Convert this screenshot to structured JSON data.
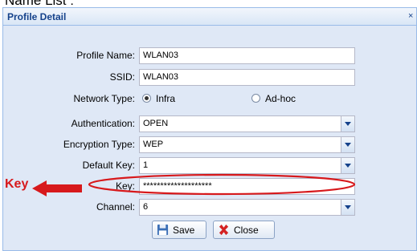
{
  "caption": "Name List :",
  "dialog": {
    "title": "Profile Detail",
    "close_glyph": "×"
  },
  "form": {
    "profile_name": {
      "label": "Profile Name:",
      "value": "WLAN03"
    },
    "ssid": {
      "label": "SSID:",
      "value": "WLAN03"
    },
    "network_type": {
      "label": "Network Type:",
      "options": [
        {
          "label": "Infra",
          "checked": true
        },
        {
          "label": "Ad-hoc",
          "checked": false
        }
      ]
    },
    "authentication": {
      "label": "Authentication:",
      "value": "OPEN"
    },
    "encryption_type": {
      "label": "Encryption Type:",
      "value": "WEP"
    },
    "default_key": {
      "label": "Default Key:",
      "value": "1"
    },
    "key": {
      "label": "Key:",
      "value": "********************"
    },
    "channel": {
      "label": "Channel:",
      "value": "6"
    }
  },
  "buttons": {
    "save": {
      "label": "Save",
      "icon": "floppy-disk-icon"
    },
    "close": {
      "label": "Close",
      "icon": "red-x-icon"
    }
  },
  "annotation": {
    "text": "Key",
    "arrow": "left-arrow-icon",
    "color": "#d7191c"
  }
}
